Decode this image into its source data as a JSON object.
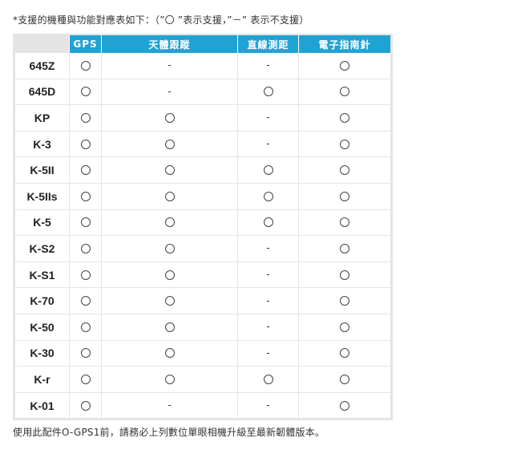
{
  "note": "*支援的機種與功能對應表如下：（”〇 ”表示支援，”－” 表示不支援）",
  "headers": {
    "model": "",
    "gps": "GPS",
    "astro": "天體跟蹤",
    "distance": "直線測距",
    "compass": "電子指南針"
  },
  "symbols": {
    "supported": "circle-icon",
    "unsupported": "-"
  },
  "rows": [
    {
      "model": "645Z",
      "gps": true,
      "astro": false,
      "distance": false,
      "compass": true
    },
    {
      "model": "645D",
      "gps": true,
      "astro": false,
      "distance": true,
      "compass": true
    },
    {
      "model": "KP",
      "gps": true,
      "astro": true,
      "distance": false,
      "compass": true
    },
    {
      "model": "K-3",
      "gps": true,
      "astro": true,
      "distance": false,
      "compass": true
    },
    {
      "model": "K-5II",
      "gps": true,
      "astro": true,
      "distance": true,
      "compass": true
    },
    {
      "model": "K-5IIs",
      "gps": true,
      "astro": true,
      "distance": true,
      "compass": true
    },
    {
      "model": "K-5",
      "gps": true,
      "astro": true,
      "distance": true,
      "compass": true
    },
    {
      "model": "K-S2",
      "gps": true,
      "astro": true,
      "distance": false,
      "compass": true
    },
    {
      "model": "K-S1",
      "gps": true,
      "astro": true,
      "distance": false,
      "compass": true
    },
    {
      "model": "K-70",
      "gps": true,
      "astro": true,
      "distance": false,
      "compass": true
    },
    {
      "model": "K-50",
      "gps": true,
      "astro": true,
      "distance": false,
      "compass": true
    },
    {
      "model": "K-30",
      "gps": true,
      "astro": true,
      "distance": false,
      "compass": true
    },
    {
      "model": "K-r",
      "gps": true,
      "astro": true,
      "distance": true,
      "compass": true
    },
    {
      "model": "K-01",
      "gps": true,
      "astro": false,
      "distance": false,
      "compass": true
    }
  ],
  "footer": "使用此配件O-GPS1前，請務必上列數位單眼相機升級至最新韌體版本。",
  "colors": {
    "header_bg": "#1fa3d3",
    "grid": "#e4e4e4"
  }
}
